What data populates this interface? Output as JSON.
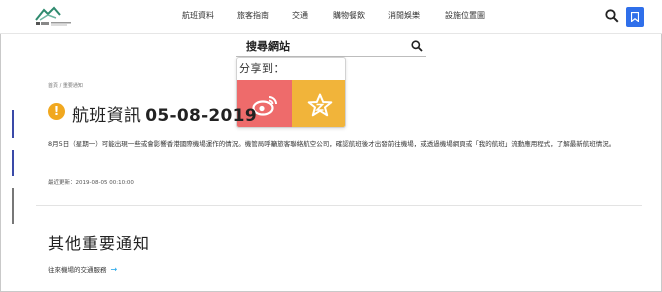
{
  "header": {
    "nav": [
      {
        "label": "航班資料"
      },
      {
        "label": "旅客指南"
      },
      {
        "label": "交通"
      },
      {
        "label": "購物餐飲"
      },
      {
        "label": "消閒娛樂"
      },
      {
        "label": "設施位置圖"
      }
    ],
    "search_icon": "search-icon",
    "bookmark_icon": "bookmark-icon"
  },
  "search": {
    "label": "搜尋網站",
    "icon": "search-icon"
  },
  "share": {
    "title": "分享到：",
    "weibo_icon": "weibo-icon",
    "favorite_icon": "star-icon",
    "weibo_color": "#ee6b6b",
    "favorite_color": "#f1b43a"
  },
  "breadcrumb": {
    "home": "首頁",
    "separator": "/",
    "current": "重要通知"
  },
  "page": {
    "title": "航班資訊",
    "date": "05-08-2019",
    "alert_icon": "!",
    "body": "8月5日（星期一）可能出現一些或會影響香港國際機場運作的情況。機管局呼籲旅客聯絡航空公司，確認航班後才出發前往機場，或透過機場網頁或「我的航班」流動應用程式，了解最新航班情況。",
    "updated_label": "最近更新：",
    "updated_value": "2019-08-05 00:10:00"
  },
  "related": {
    "title": "其他重要通知",
    "link": "往來機場的交通服務",
    "arrow": "→"
  },
  "colors": {
    "accent": "#2f6fea",
    "alert": "#f1a81f",
    "side_bar": "#3a4aa8",
    "link_arrow": "#1aa3e8"
  }
}
